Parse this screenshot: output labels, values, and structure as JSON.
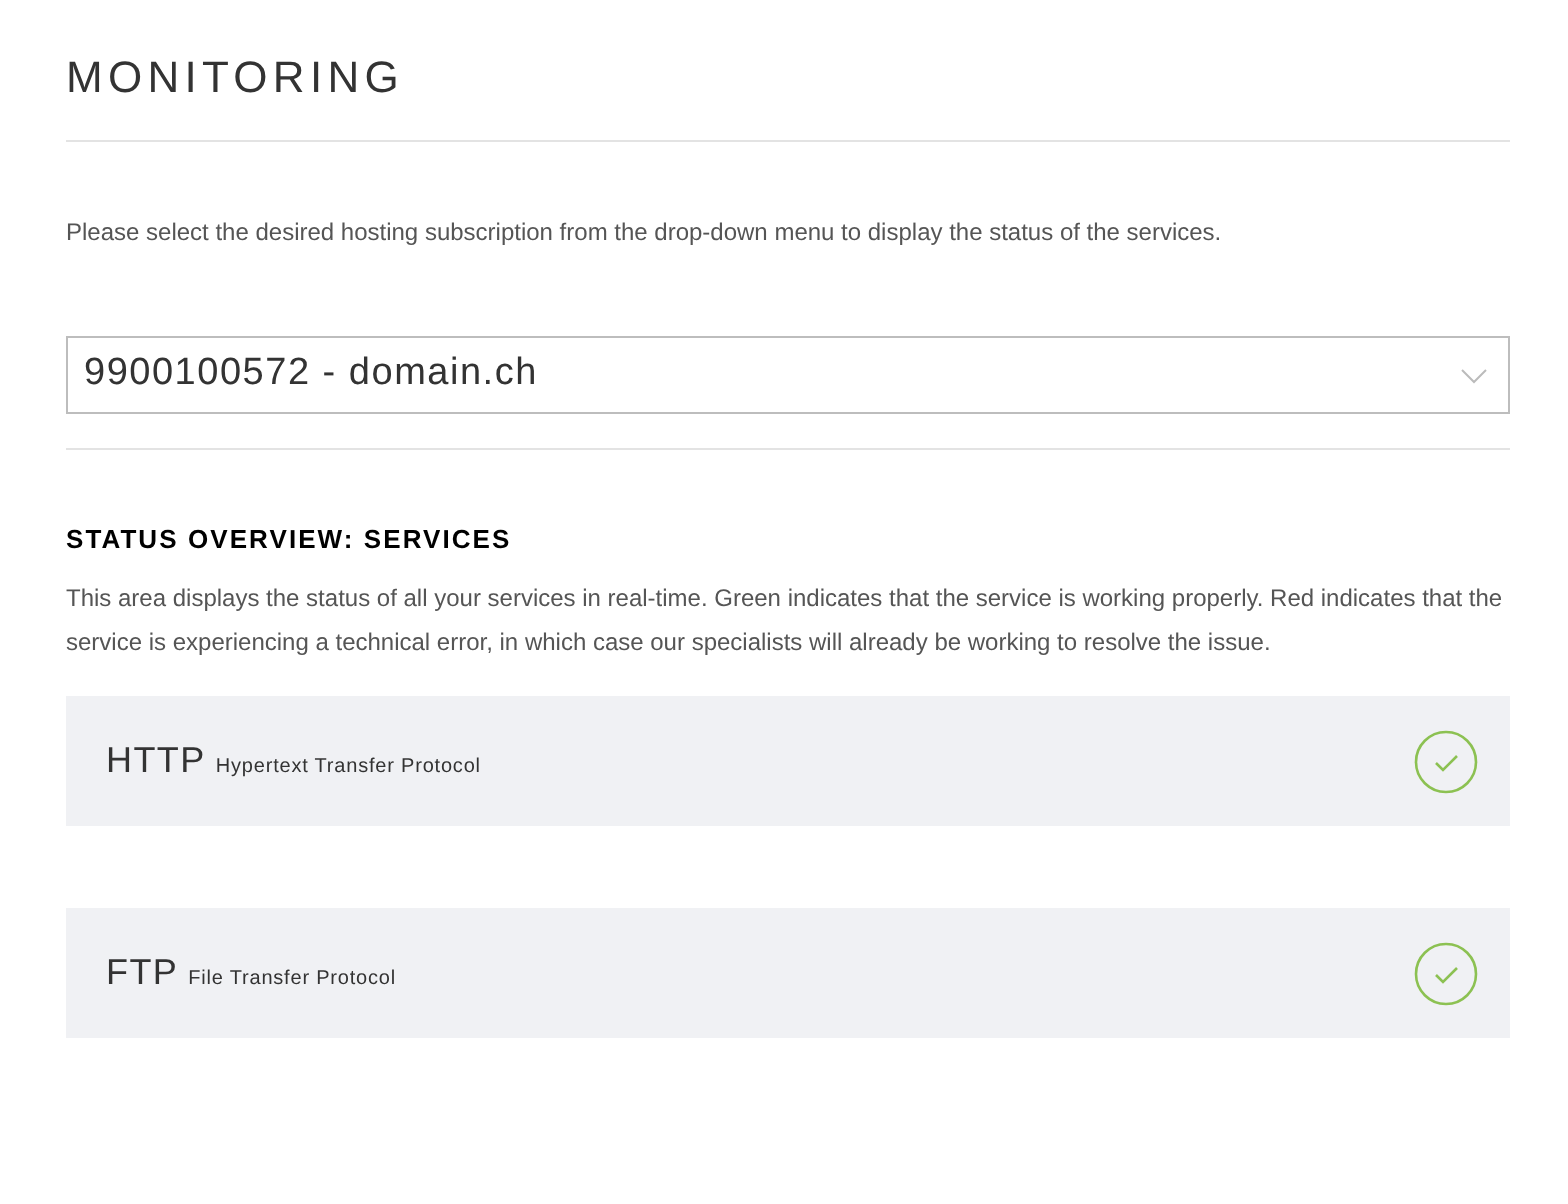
{
  "title": "MONITORING",
  "intro": "Please select the desired hosting subscription from the drop-down menu to display the status of the services.",
  "subscription_select": {
    "value": "9900100572 - domain.ch"
  },
  "section": {
    "heading": "STATUS OVERVIEW: SERVICES",
    "description": "This area displays the status of all your services in real-time. Green indicates that the service is working properly. Red indicates that the service is experiencing a technical error, in which case our specialists will already be working to resolve the issue."
  },
  "services": [
    {
      "name": "HTTP",
      "full_name": "Hypertext Transfer Protocol",
      "working": true
    },
    {
      "name": "FTP",
      "full_name": "File Transfer Protocol",
      "working": true
    }
  ]
}
